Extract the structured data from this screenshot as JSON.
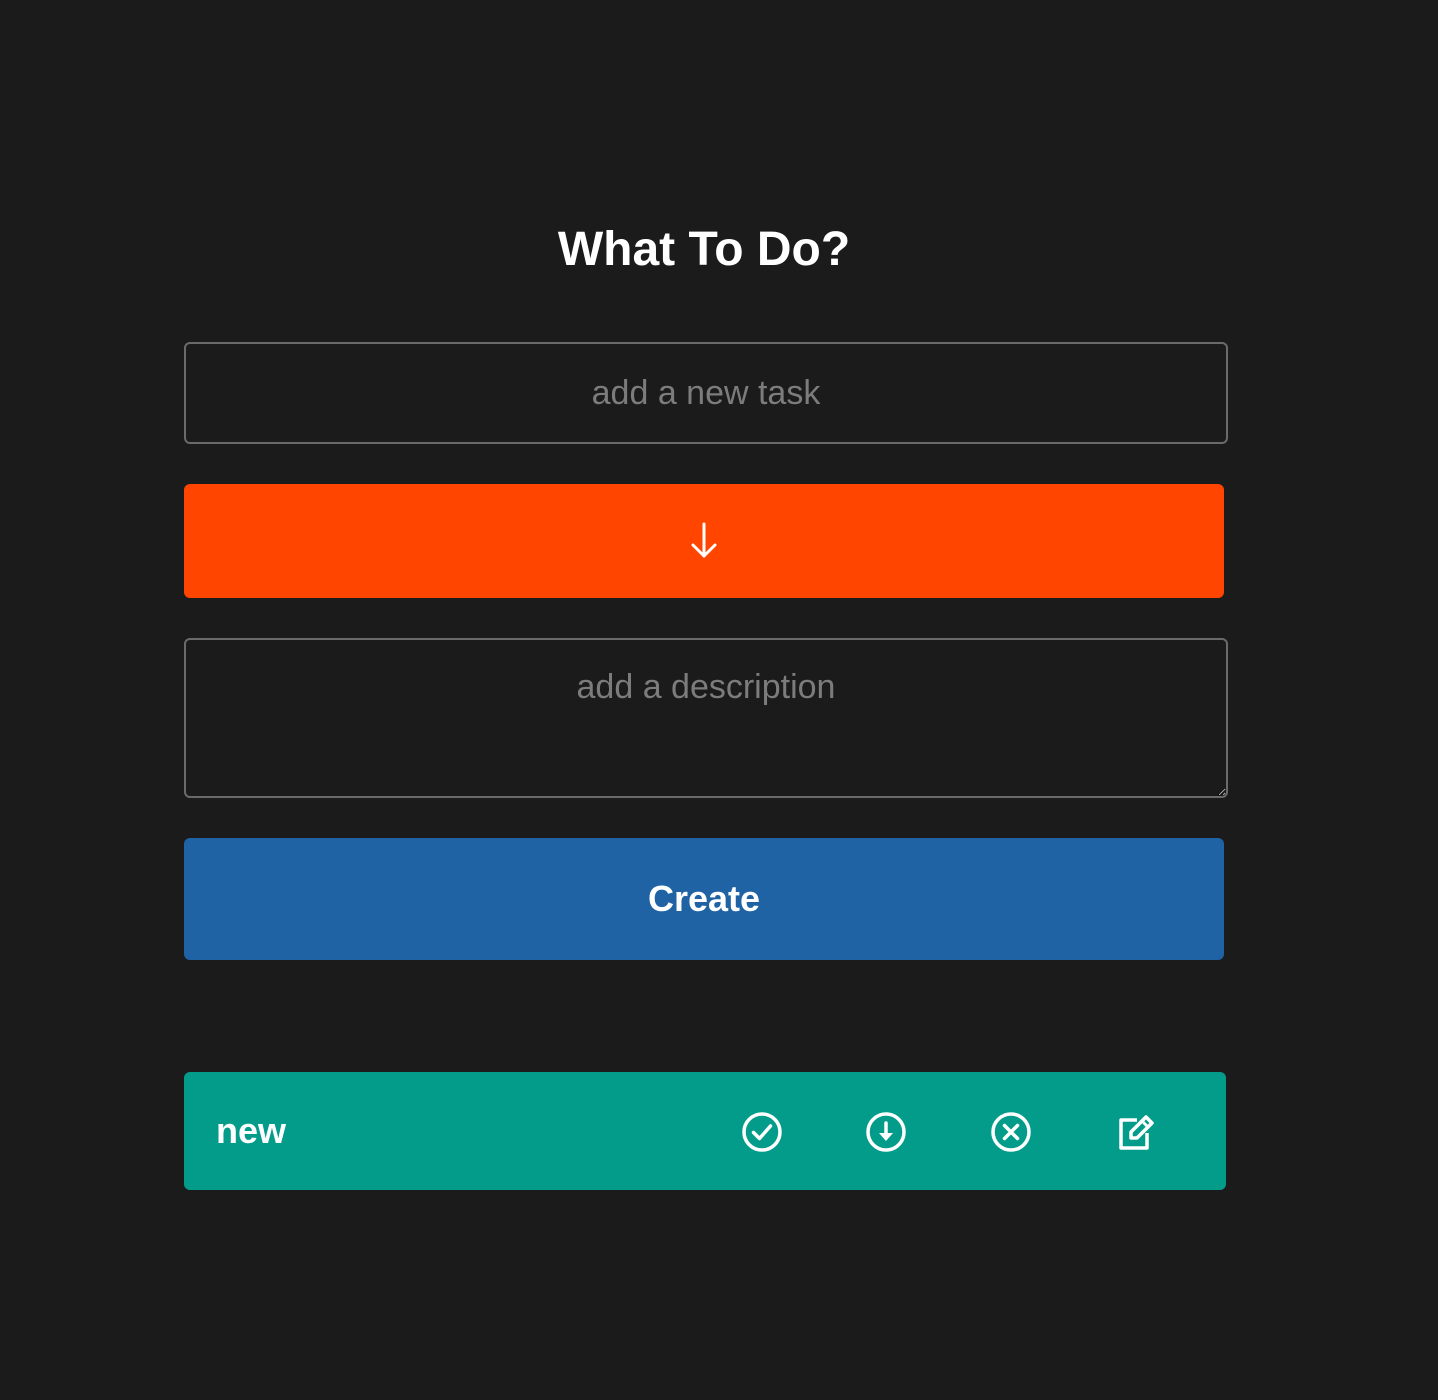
{
  "header": {
    "title": "What To Do?"
  },
  "form": {
    "task_placeholder": "add a new task",
    "task_value": "",
    "priority_icon": "arrow-down-icon",
    "priority_color": "#ff4500",
    "description_placeholder": "add a description",
    "description_value": "",
    "create_label": "Create",
    "create_color": "#1f63a4"
  },
  "tasks": [
    {
      "name": "new",
      "color": "#039c8a",
      "actions": [
        {
          "icon": "check-circle-icon"
        },
        {
          "icon": "arrow-down-circle-icon"
        },
        {
          "icon": "x-circle-icon"
        },
        {
          "icon": "edit-icon"
        }
      ]
    }
  ],
  "colors": {
    "background": "#1b1b1b",
    "text": "#ffffff",
    "placeholder": "#7c7c7c",
    "border": "#6a6a6a"
  }
}
